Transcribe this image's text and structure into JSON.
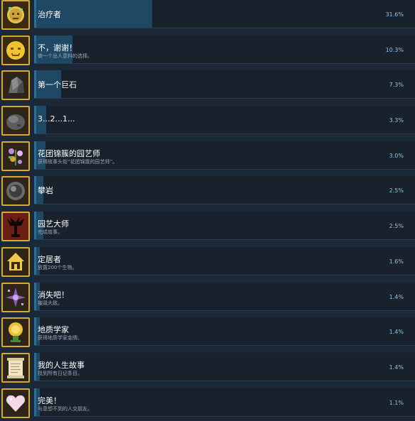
{
  "achievements": [
    {
      "title": "治疗者",
      "description": "",
      "percent": "31.6%",
      "value": 31.6,
      "icon": "healer-face-icon"
    },
    {
      "title": "不，谢谢！",
      "description": "做一个出人意料的选择。",
      "percent": "10.3%",
      "value": 10.3,
      "icon": "sad-face-icon"
    },
    {
      "title": "第一个巨石",
      "description": "",
      "percent": "7.3%",
      "value": 7.3,
      "icon": "boulder-icon"
    },
    {
      "title": "3...2...1...",
      "description": "",
      "percent": "3.3%",
      "value": 3.3,
      "icon": "rock-icon"
    },
    {
      "title": "花团锦簇的园艺师",
      "description": "获得故事头衔“花团锦簇的园艺师”。",
      "percent": "3.0%",
      "value": 3.0,
      "icon": "flower-icon"
    },
    {
      "title": "攀岩",
      "description": "",
      "percent": "2.5%",
      "value": 2.5,
      "icon": "climbing-rock-icon"
    },
    {
      "title": "园艺大师",
      "description": "完成故事。",
      "percent": "2.5%",
      "value": 2.5,
      "icon": "tree-silhouette-icon"
    },
    {
      "title": "定居者",
      "description": "放置200个生物。",
      "percent": "1.6%",
      "value": 1.6,
      "icon": "house-icon"
    },
    {
      "title": "消失吧！",
      "description": "摧毁大敌。",
      "percent": "1.4%",
      "value": 1.4,
      "icon": "sparkle-icon"
    },
    {
      "title": "地质学家",
      "description": "获得地质学家金牌。",
      "percent": "1.4%",
      "value": 1.4,
      "icon": "gold-medal-icon"
    },
    {
      "title": "我的人生故事",
      "description": "找到所有日记条目。",
      "percent": "1.4%",
      "value": 1.4,
      "icon": "scroll-icon"
    },
    {
      "title": "完美！",
      "description": "与意想不到的人交朋友。",
      "percent": "1.1%",
      "value": 1.1,
      "icon": "heart-icon"
    }
  ],
  "colors": {
    "background": "#1b2838",
    "bar_fill": "#1e4863",
    "icon_border": "#d8a92f",
    "percent_text": "#8fc3e8"
  }
}
